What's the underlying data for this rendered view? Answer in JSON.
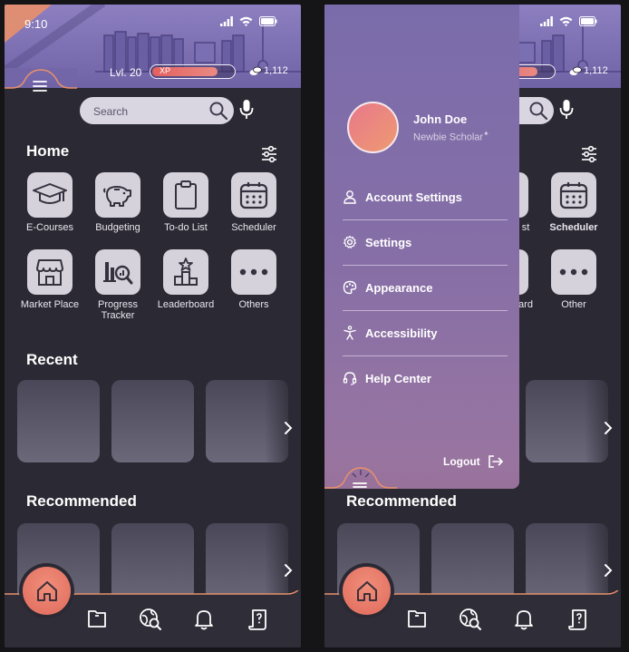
{
  "status": {
    "time": "9:10"
  },
  "profile": {
    "level": "Lvl. 20",
    "xp_label": "XP",
    "xp_progress": 0.82,
    "coins": "1,112"
  },
  "search": {
    "placeholder": "Search"
  },
  "home": {
    "title": "Home",
    "apps_row1": [
      {
        "label": "E-Courses",
        "icon": "graduation-cap-icon"
      },
      {
        "label": "Budgeting",
        "icon": "piggy-bank-icon"
      },
      {
        "label": "To-do List",
        "icon": "clipboard-icon"
      },
      {
        "label": "Scheduler",
        "icon": "calendar-icon"
      }
    ],
    "apps_row2": [
      {
        "label": "Market Place",
        "icon": "storefront-icon"
      },
      {
        "label": "Progress Tracker",
        "icon": "chart-search-icon"
      },
      {
        "label": "Leaderboard",
        "icon": "podium-icon"
      },
      {
        "label": "Others",
        "icon": "more-icon"
      }
    ]
  },
  "recent": {
    "title": "Recent"
  },
  "recommended": {
    "title": "Recommended"
  },
  "drawer_screen": {
    "visible_tiles": {
      "list_fragment": "st",
      "scheduler": "Scheduler",
      "board_fragment": "ard",
      "other": "Other"
    },
    "recommended_fragment": "Recommended",
    "user": {
      "name": "John Doe",
      "rank": "Newbie Scholar"
    },
    "menu": [
      {
        "label": "Account Settings",
        "icon": "user-icon"
      },
      {
        "label": "Settings",
        "icon": "gear-icon"
      },
      {
        "label": "Appearance",
        "icon": "palette-icon"
      },
      {
        "label": "Accessibility",
        "icon": "accessibility-icon"
      },
      {
        "label": "Help Center",
        "icon": "headset-icon"
      }
    ],
    "logout_label": "Logout"
  },
  "colors": {
    "accent": "#e8786b",
    "background": "#2b2933",
    "banner": "#7c70b2",
    "drawer": "#8a70a6"
  }
}
